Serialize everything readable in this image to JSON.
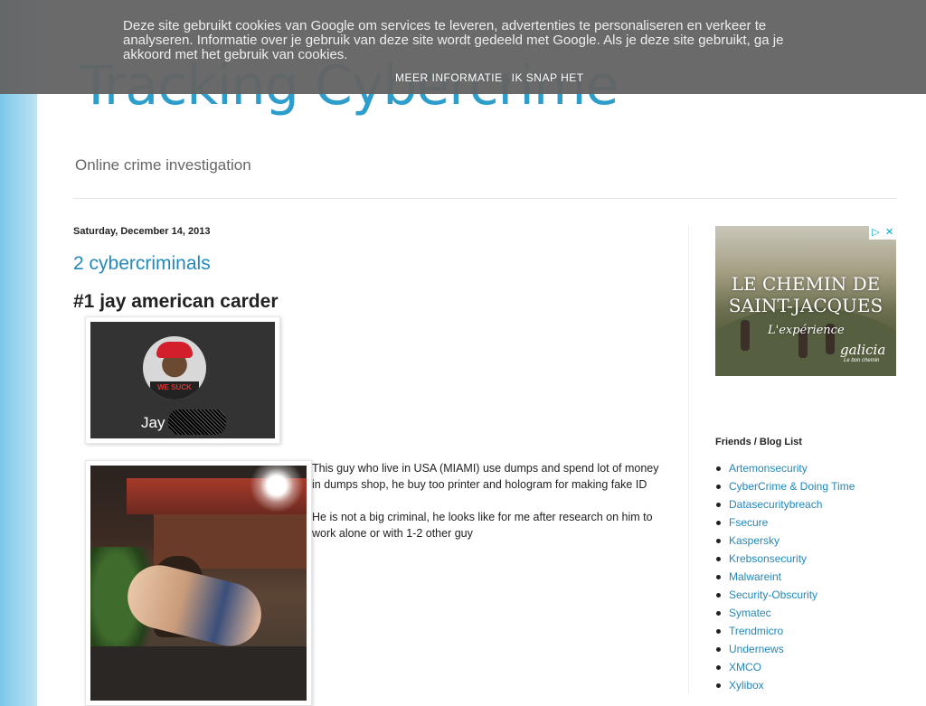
{
  "blog": {
    "title": "Tracking Cybercrime",
    "description": "Online crime investigation"
  },
  "post": {
    "date": "Saturday, December 14, 2013",
    "title": "2 cybercriminals",
    "heading": "#1 jay american carder",
    "profile_name": "Jay",
    "avatar_shirt_text": "WE SUCK",
    "paragraphs": [
      "This guy who live in USA (MIAMI) use dumps and spend lot of money in dumps shop, he buy too printer and hologram for making fake ID",
      "He is not a big criminal, he looks like for me after research on him to work alone or with 1-2 other guy"
    ]
  },
  "sidebar": {
    "ad": {
      "headline_line1": "LE CHEMIN DE",
      "headline_line2": "SAINT-JACQUES",
      "tagline": "L'expérience",
      "brand": "galicia",
      "brand_sub": "Le bon chemin",
      "adchoices_icon": "ad-choices-icon",
      "close_icon": "close-icon"
    },
    "blog_list_title": "Friends / Blog List",
    "blog_list": [
      "Artemonsecurity",
      "CyberCrime & Doing Time",
      "Datasecuritybreach",
      "Fsecure",
      "Kaspersky",
      "Krebsonsecurity",
      "Malwareint",
      "Security-Obscurity",
      "Symatec",
      "Trendmicro",
      "Undernews",
      "XMCO",
      "Xylibox"
    ]
  },
  "cookie_banner": {
    "text": "Deze site gebruikt cookies van Google om services te leveren, advertenties te personaliseren en verkeer te analyseren. Informatie over je gebruik van deze site wordt gedeeld met Google. Als je deze site gebruikt, ga je akkoord met het gebruik van cookies.",
    "more_info_label": "MEER INFORMATIE",
    "accept_label": "IK SNAP HET"
  },
  "colors": {
    "link": "#2288bb",
    "title": "#2d9dcc",
    "banner_bg": "#646464"
  }
}
